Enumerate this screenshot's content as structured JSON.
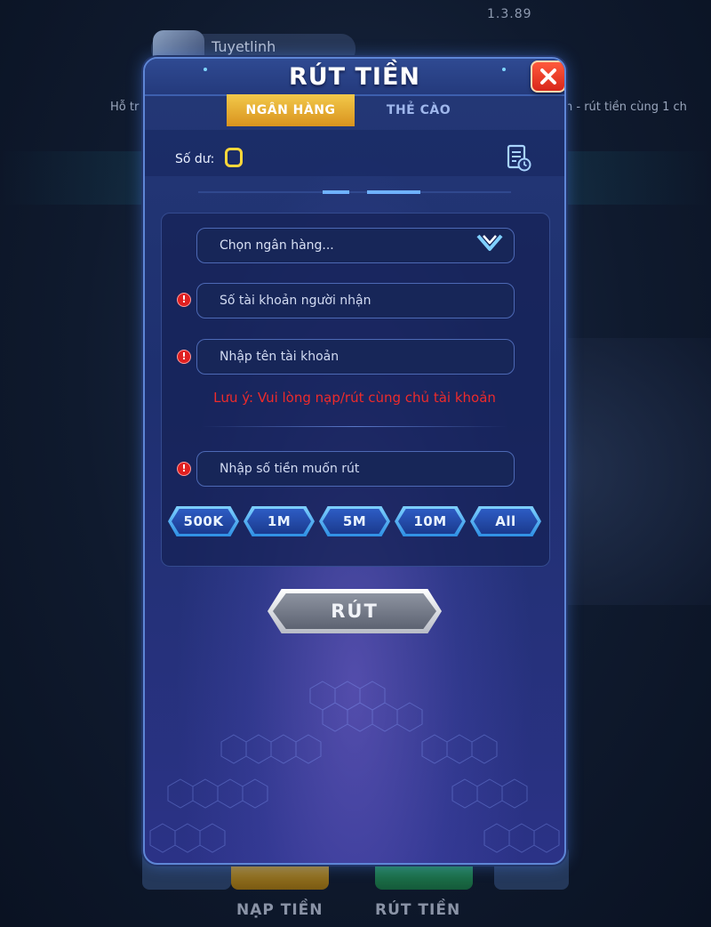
{
  "background": {
    "version": "1.3.89",
    "username": "Tuyetlinh",
    "marquee_left": "Hỗ tr",
    "marquee_right": "n - rút tiền cùng 1 ch",
    "bottom_nav": {
      "deposit": "NẠP TIỀN",
      "withdraw": "RÚT TIỀN"
    }
  },
  "dialog": {
    "title": "RÚT TIỀN",
    "tabs": [
      {
        "label": "NGÂN HÀNG",
        "active": true
      },
      {
        "label": "THẺ CÀO",
        "active": false
      }
    ],
    "balance": {
      "label": "Số dư:",
      "value": "0"
    },
    "form": {
      "bank_select": {
        "value": "Chọn ngân hàng..."
      },
      "account_number": {
        "placeholder": "Số tài khoản người nhận"
      },
      "account_name": {
        "placeholder": "Nhập tên tài khoản"
      },
      "note": "Lưu ý: Vui lòng nạp/rút cùng chủ tài khoản",
      "amount": {
        "placeholder": "Nhập số tiền muốn rút"
      },
      "quick_amounts": [
        "500K",
        "1M",
        "5M",
        "10M",
        "All"
      ]
    },
    "submit_label": "RÚT"
  },
  "colors": {
    "accent_gold": "#f2c94a",
    "warning_red": "#ee2b2b",
    "close_red": "#d8261a",
    "panel_blue": "#243876"
  },
  "icons": {
    "close": "close-icon",
    "history": "history-icon",
    "dropdown": "chevron-down-icon",
    "info": "info-icon"
  }
}
